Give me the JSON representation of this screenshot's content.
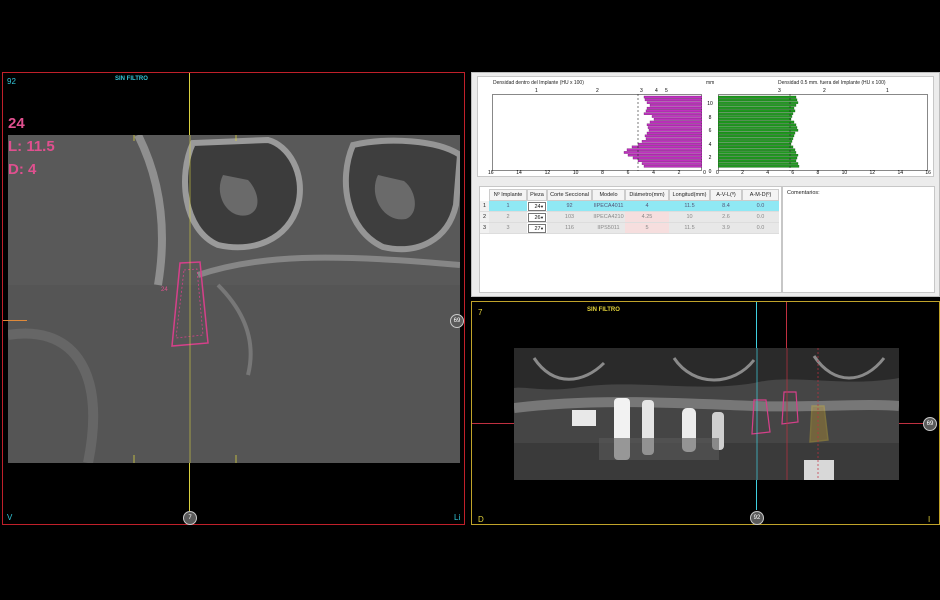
{
  "left_view": {
    "slice": "92",
    "filter": "SIN FILTRO",
    "tooth": "24",
    "length": "L: 11.5",
    "diameter": "D: 4",
    "implant_label": "24",
    "corner_bl": "V",
    "corner_br": "Li",
    "badge_bottom": "7",
    "badge_right": "69"
  },
  "chart": {
    "left_title": "Densidad dentro del Implante (HU x 100)",
    "right_title": "Densidad 0.5 mm. fuera del Implante (HU x 100)",
    "unit_label": "mm",
    "left_top_ticks": [
      "1",
      "2",
      "3",
      "4",
      "5"
    ],
    "right_top_ticks": [
      "3",
      "2",
      "1"
    ],
    "left_bottom_ticks": [
      "16",
      "14",
      "12",
      "10",
      "8",
      "6",
      "4",
      "2",
      "0"
    ],
    "right_bottom_ticks": [
      "0",
      "2",
      "4",
      "6",
      "8",
      "10",
      "12",
      "14",
      "16"
    ],
    "mm_ticks": [
      "10",
      "8",
      "6",
      "4",
      "2",
      "0"
    ],
    "inside_color": "#c030c0",
    "outside_color": "#1e9a1e"
  },
  "table": {
    "headers": [
      "Nº Implante",
      "Pieza",
      "Corte Seccional",
      "Modelo",
      "Diámetro(mm)",
      "Longitud(mm)",
      "A-V-L(º)",
      "A-M-D(º)"
    ],
    "rows": [
      {
        "idx": "1",
        "num": "1",
        "pieza": "24",
        "corte": "92",
        "modelo": "IIPECA4011",
        "diam": "4",
        "long": "11.5",
        "avl": "8.4",
        "amd": "0.0"
      },
      {
        "idx": "2",
        "num": "2",
        "pieza": "26",
        "corte": "103",
        "modelo": "IIPECA4210",
        "diam": "4.25",
        "long": "10",
        "avl": "2.6",
        "amd": "0.0"
      },
      {
        "idx": "3",
        "num": "3",
        "pieza": "27",
        "corte": "116",
        "modelo": "IIPS5011",
        "diam": "5",
        "long": "11.5",
        "avl": "3.9",
        "amd": "0.0"
      }
    ],
    "comments_label": "Comentarios:"
  },
  "right_view": {
    "slice": "7",
    "filter": "SIN FILTRO",
    "corner_bl": "D",
    "corner_br": "I",
    "badge_bottom": "92",
    "badge_right": "69"
  }
}
